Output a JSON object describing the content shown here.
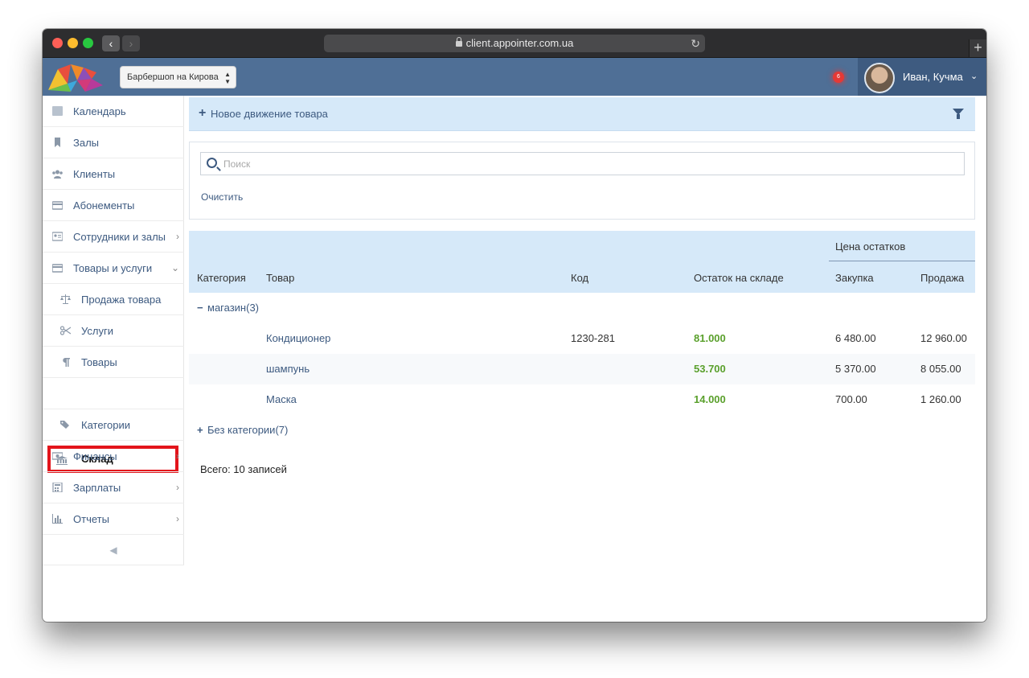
{
  "browser": {
    "url": "client.appointer.com.ua",
    "back_glyph": "‹",
    "forward_glyph": "›",
    "reload_glyph": "↻",
    "newtab_glyph": "+"
  },
  "header": {
    "branch_select": "Барбершоп на Кирова",
    "notification_count": "6",
    "user_name": "Иван, Кучма",
    "colors": {
      "header_bg": "#4f6f96",
      "user_bg": "#3e5b80",
      "badge": "#e53935"
    }
  },
  "sidebar": {
    "items": [
      {
        "label": "Календарь",
        "icon": "calendar-icon"
      },
      {
        "label": "Залы",
        "icon": "bookmark-icon"
      },
      {
        "label": "Клиенты",
        "icon": "users-icon"
      },
      {
        "label": "Абонементы",
        "icon": "card-icon"
      },
      {
        "label": "Сотрудники и залы",
        "icon": "id-card-icon"
      },
      {
        "label": "Товары и услуги",
        "icon": "card-icon"
      },
      {
        "label": "Продажа товара",
        "icon": "scales-icon"
      },
      {
        "label": "Услуги",
        "icon": "scissors-icon"
      },
      {
        "label": "Товары",
        "icon": "paragraph-icon"
      },
      {
        "label": "Склад",
        "icon": "bank-icon"
      },
      {
        "label": "Категории",
        "icon": "tags-icon"
      },
      {
        "label": "Финансы",
        "icon": "money-icon"
      },
      {
        "label": "Зарплаты",
        "icon": "calculator-icon"
      },
      {
        "label": "Отчеты",
        "icon": "bar-chart-icon"
      }
    ],
    "chevron_right": "›",
    "chevron_down": "⌄",
    "collapse_glyph": "◀"
  },
  "toolbar": {
    "new_movement_plus": "+",
    "new_movement_label": "Новое движение товара"
  },
  "search": {
    "placeholder": "Поиск",
    "value": "",
    "clear_label": "Очистить"
  },
  "table": {
    "headers": {
      "category": "Категория",
      "product": "Товар",
      "code": "Код",
      "stock": "Остаток на складе",
      "price_group": "Цена остатков",
      "purchase": "Закупка",
      "sale": "Продажа"
    },
    "groups": [
      {
        "toggle": "−",
        "label": "магазин(3)",
        "rows": [
          {
            "product": "Кондиционер",
            "code": "1230-281",
            "stock": "81.000",
            "purchase": "6 480.00",
            "sale": "12 960.00"
          },
          {
            "product": "шампунь",
            "code": "",
            "stock": "53.700",
            "purchase": "5 370.00",
            "sale": "8 055.00"
          },
          {
            "product": "Маска",
            "code": "",
            "stock": "14.000",
            "purchase": "700.00",
            "sale": "1 260.00"
          }
        ]
      },
      {
        "toggle": "+",
        "label": "Без категории(7)",
        "rows": []
      }
    ],
    "total": "Всего: 10 записей"
  }
}
